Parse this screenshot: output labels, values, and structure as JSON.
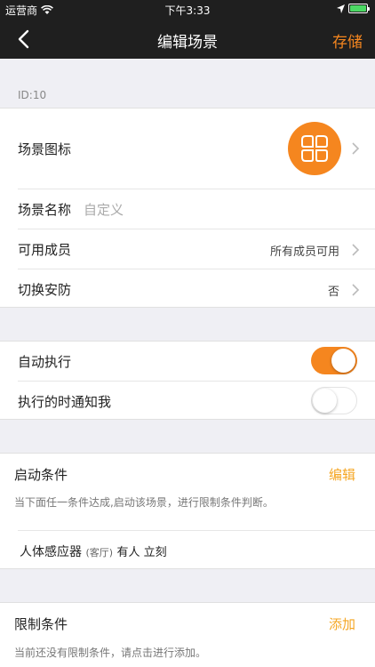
{
  "status_bar": {
    "carrier": "运营商",
    "time": "下午3:33"
  },
  "nav": {
    "title": "编辑场景",
    "save": "存储"
  },
  "scene": {
    "id_label": "ID:10",
    "icon_label": "场景图标",
    "name_label": "场景名称",
    "name_placeholder": "自定义",
    "members_label": "可用成员",
    "members_value": "所有成员可用",
    "security_label": "切换安防",
    "security_value": "否"
  },
  "automation": {
    "auto_label": "自动执行",
    "auto_on": true,
    "notify_label": "执行的时通知我",
    "notify_on": false
  },
  "trigger": {
    "title": "启动条件",
    "action": "编辑",
    "hint": "当下面任一条件达成,启动该场景，进行限制条件判断。",
    "item_name": "人体感应器",
    "item_room": "(客厅)",
    "item_state": "有人 立刻"
  },
  "limit": {
    "title": "限制条件",
    "action": "添加",
    "hint": "当前还没有限制条件，请点击进行添加。"
  },
  "colors": {
    "accent": "#f5861f",
    "nav_bg": "#1f1f1f",
    "page_bg": "#efeff4"
  }
}
